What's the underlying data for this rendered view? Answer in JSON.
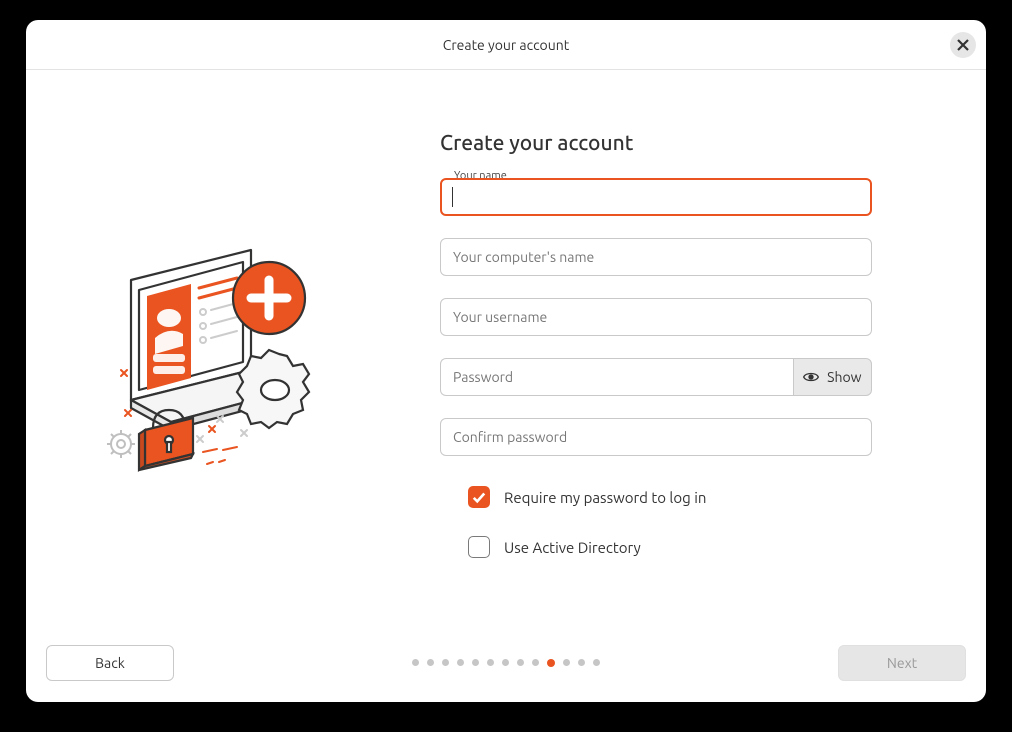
{
  "titlebar": {
    "title": "Create your account"
  },
  "page": {
    "heading": "Create your account"
  },
  "form": {
    "name": {
      "label": "Your name",
      "value": ""
    },
    "computer_name": {
      "placeholder": "Your computer's name",
      "value": ""
    },
    "username": {
      "placeholder": "Your username",
      "value": ""
    },
    "password": {
      "placeholder": "Password",
      "value": "",
      "show_button": "Show"
    },
    "confirm_password": {
      "placeholder": "Confirm password",
      "value": ""
    },
    "require_password": {
      "label": "Require my password to log in",
      "checked": true
    },
    "active_directory": {
      "label": "Use Active Directory",
      "checked": false
    }
  },
  "footer": {
    "back": "Back",
    "next": "Next"
  },
  "progress": {
    "total": 13,
    "active_index": 9
  },
  "colors": {
    "accent": "#e95420"
  }
}
